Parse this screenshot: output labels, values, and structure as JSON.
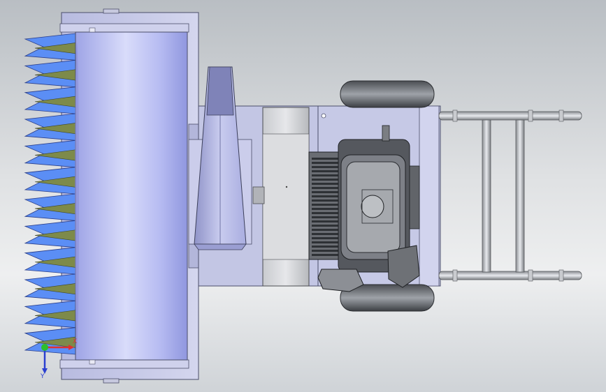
{
  "viewport": {
    "background_top": "#b9bec3",
    "background_bottom": "#eeeff0"
  },
  "model": {
    "view": "top",
    "components": [
      "auger-teeth",
      "auger-drum",
      "auger-housing",
      "discharge-chute",
      "frame",
      "gearbox",
      "engine",
      "wheels",
      "handlebar"
    ],
    "colors": {
      "housing": "#c8cbe6",
      "drum": "#aab0ee",
      "teeth_blue": "#5b8ef5",
      "teeth_olive": "#7d8a4a",
      "engine_dark": "#3a3d42",
      "frame_gray": "#c2c4c8"
    }
  },
  "triad": {
    "x_label": "X",
    "y_label": "Y",
    "x_color": "#e03030",
    "y_color": "#2a3fd0",
    "origin_color": "#2cbf2c"
  }
}
